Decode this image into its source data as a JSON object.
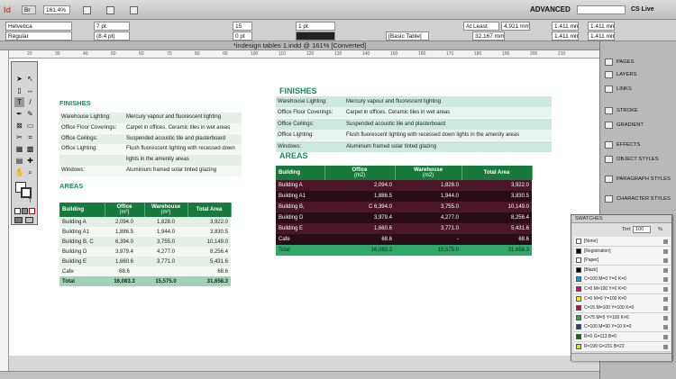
{
  "menubar": {
    "font_size": "8 pt",
    "zoom": "161.4%",
    "mode": "ADVANCED",
    "cs_live": "CS Live"
  },
  "control": {
    "font": "Helvetica",
    "style": "Regular",
    "size": "7 pt",
    "leading": "(8.4 pt)",
    "tracking": "15",
    "baseline": "0 pt",
    "stroke": "1 pt",
    "table_style": "[Basic Table]",
    "row_height": "At Least",
    "row_val": "4.921 mm",
    "col_width": "32.167 mm",
    "inset1": "1.411 mm",
    "inset2": "1.411 mm",
    "inset3": "1.411 mm",
    "inset4": "1.411 mm"
  },
  "document": {
    "title": "*indesign tables 1.indd @ 161% [Converted]",
    "ruler_ticks": [
      "20",
      "30",
      "40",
      "50",
      "60",
      "70",
      "80",
      "90",
      "100",
      "110",
      "120",
      "130",
      "140",
      "150",
      "160",
      "170",
      "180",
      "190",
      "200",
      "210"
    ]
  },
  "left": {
    "finishes_title": "FINISHES",
    "finishes": [
      {
        "label": "Warehouse Lighting:",
        "value": "Mercury vapour and fluorescent lighting"
      },
      {
        "label": "Office Floor Coverings:",
        "value": "Carpet in offices. Ceramic tiles in wet areas"
      },
      {
        "label": "Office Ceilings:",
        "value": "Suspended acoustic tile and plasterboard"
      },
      {
        "label": "Office Lighting:",
        "value": "Flush fluorescent lighting with recessed down"
      },
      {
        "label": "",
        "value": "lights in the amenity areas"
      },
      {
        "label": "Windows:",
        "value": "Aluminium framed solar tinted glazing"
      }
    ],
    "areas_title": "AREAS",
    "headers": [
      "Building",
      "Office",
      "Warehouse",
      "Total Area"
    ],
    "units": [
      "",
      "(m²)",
      "(m²)",
      ""
    ],
    "rows": [
      [
        "Building A",
        "2,094.0",
        "1,828.0",
        "3,922.0"
      ],
      [
        "Building A1",
        "1,886.5",
        "1,944.0",
        "3,830.5"
      ],
      [
        "Building B, C",
        "6,394.0",
        "3,755.0",
        "10,149.0"
      ],
      [
        "Building D",
        "3,979.4",
        "4,277.0",
        "8,256.4"
      ],
      [
        "Building E",
        "1,660.6",
        "3,771.0",
        "5,431.6"
      ],
      [
        "Cafe",
        "68.6",
        "",
        "68.6"
      ],
      [
        "Total",
        "16,083.3",
        "15,575.0",
        "31,658.3"
      ]
    ]
  },
  "right": {
    "finishes_title": "FINISHES",
    "finishes": [
      {
        "label": "Warehouse Lighting:",
        "value": "Mercury vapour and fluorescent lighting"
      },
      {
        "label": "Office Floor Coverings:",
        "value": "Carpet in offices. Ceramic tiles in wet areas"
      },
      {
        "label": "Office Ceilings:",
        "value": "Suspended acoustic tile and plasterboard"
      },
      {
        "label": "Office Lighting:",
        "value": "Flush fluorescent lighting with recessed down lights in the amenity areas"
      },
      {
        "label": "Windows:",
        "value": "Aluminium framed solar tinted glazing"
      }
    ],
    "areas_title": "AREAS",
    "headers": [
      "Building",
      "Office",
      "Warehouse",
      "Total Area"
    ],
    "units": [
      "",
      "(m2)",
      "(m2)",
      ""
    ],
    "rows": [
      [
        "Building A",
        "2,094.0",
        "1,828.0",
        "3,922.0"
      ],
      [
        "Building A1",
        "1,886.5",
        "1,944.0",
        "3,830.5"
      ],
      [
        "Building B,",
        "C 6,394.0",
        "3,755.0",
        "10,149.0"
      ],
      [
        "Building D",
        "3,979.4",
        "4,277.0",
        "8,256.4"
      ],
      [
        "Building E",
        "1,660.6",
        "3,771.0",
        "5,431.6"
      ],
      [
        "Cafe",
        "68.6",
        "-",
        "68.6"
      ],
      [
        "Total",
        "16,083.3",
        "15,575.0",
        "31,658.3"
      ]
    ]
  },
  "panels": {
    "items": [
      "PAGES",
      "LAYERS",
      "LINKS",
      "STROKE",
      "GRADIENT",
      "EFFECTS",
      "OBJECT STYLES",
      "PARAGRAPH STYLES",
      "CHARACTER STYLES"
    ]
  },
  "swatches": {
    "title": "SWATCHES",
    "tint_label": "Tint:",
    "tint": "100",
    "pct": "%",
    "items": [
      {
        "name": "[None]",
        "color": "#ffffff"
      },
      {
        "name": "[Registration]",
        "color": "#000000"
      },
      {
        "name": "[Paper]",
        "color": "#ffffff"
      },
      {
        "name": "[Black]",
        "color": "#000000"
      },
      {
        "name": "C=100 M=0 Y=0 K=0",
        "color": "#00a0e0"
      },
      {
        "name": "C=0 M=100 Y=0 K=0",
        "color": "#e0007a"
      },
      {
        "name": "C=0 M=0 Y=100 K=0",
        "color": "#fff000"
      },
      {
        "name": "C=15 M=100 Y=100 K=0",
        "color": "#c8102e"
      },
      {
        "name": "C=75 M=5 Y=100 K=0",
        "color": "#2aa84a"
      },
      {
        "name": "C=100 M=90 Y=10 K=0",
        "color": "#1f3f98"
      },
      {
        "name": "R=0 G=113 B=0",
        "color": "#007100"
      },
      {
        "name": "R=199 G=231 B=22",
        "color": "#c7e716"
      }
    ]
  }
}
